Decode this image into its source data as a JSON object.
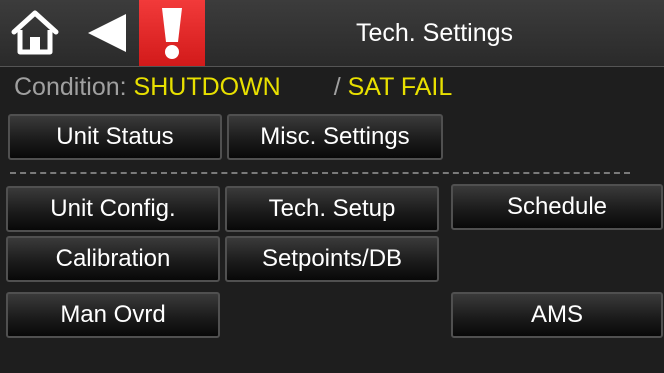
{
  "header": {
    "title": "Tech. Settings",
    "home_icon": "home-icon",
    "back_icon": "back-arrow-icon",
    "alarm_icon": "exclamation-alarm-icon"
  },
  "status": {
    "label": "Condition:",
    "condition": "SHUTDOWN",
    "separator": "/",
    "fault": "SAT FAIL"
  },
  "buttons": {
    "unit_status": "Unit Status",
    "misc_settings": "Misc. Settings",
    "unit_config": "Unit Config.",
    "tech_setup": "Tech. Setup",
    "schedule": "Schedule",
    "calibration": "Calibration",
    "setpoints_db": "Setpoints/DB",
    "man_ovrd": "Man Ovrd",
    "ams": "AMS"
  },
  "colors": {
    "status_value": "#e8e000",
    "alarm": "#e02020",
    "background": "#1e1e1e"
  }
}
